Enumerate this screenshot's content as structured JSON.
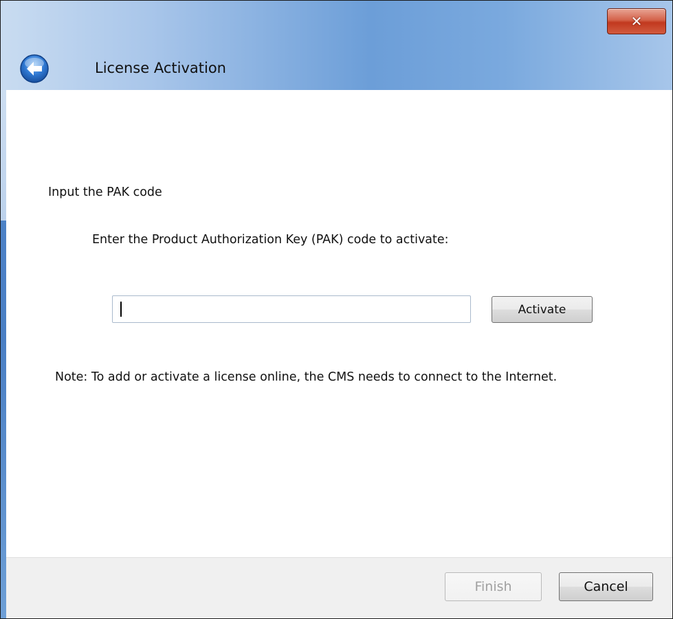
{
  "window": {
    "title": "License Activation",
    "close_icon": "close-icon"
  },
  "nav": {
    "back_icon": "back-arrow-icon"
  },
  "content": {
    "heading": "Input the PAK code",
    "description": "Enter the Product Authorization Key (PAK) code to activate:",
    "pak_input": {
      "value": "",
      "placeholder": ""
    },
    "activate_label": "Activate",
    "note": "Note: To add or activate a license online, the CMS needs to connect to the Internet."
  },
  "footer": {
    "finish_label": "Finish",
    "finish_enabled": false,
    "cancel_label": "Cancel"
  },
  "colors": {
    "frame": "#4a7fc4",
    "close_button": "#c1391f",
    "back_button": "#2a6fc9",
    "footer_bg": "#f0f0f0"
  }
}
